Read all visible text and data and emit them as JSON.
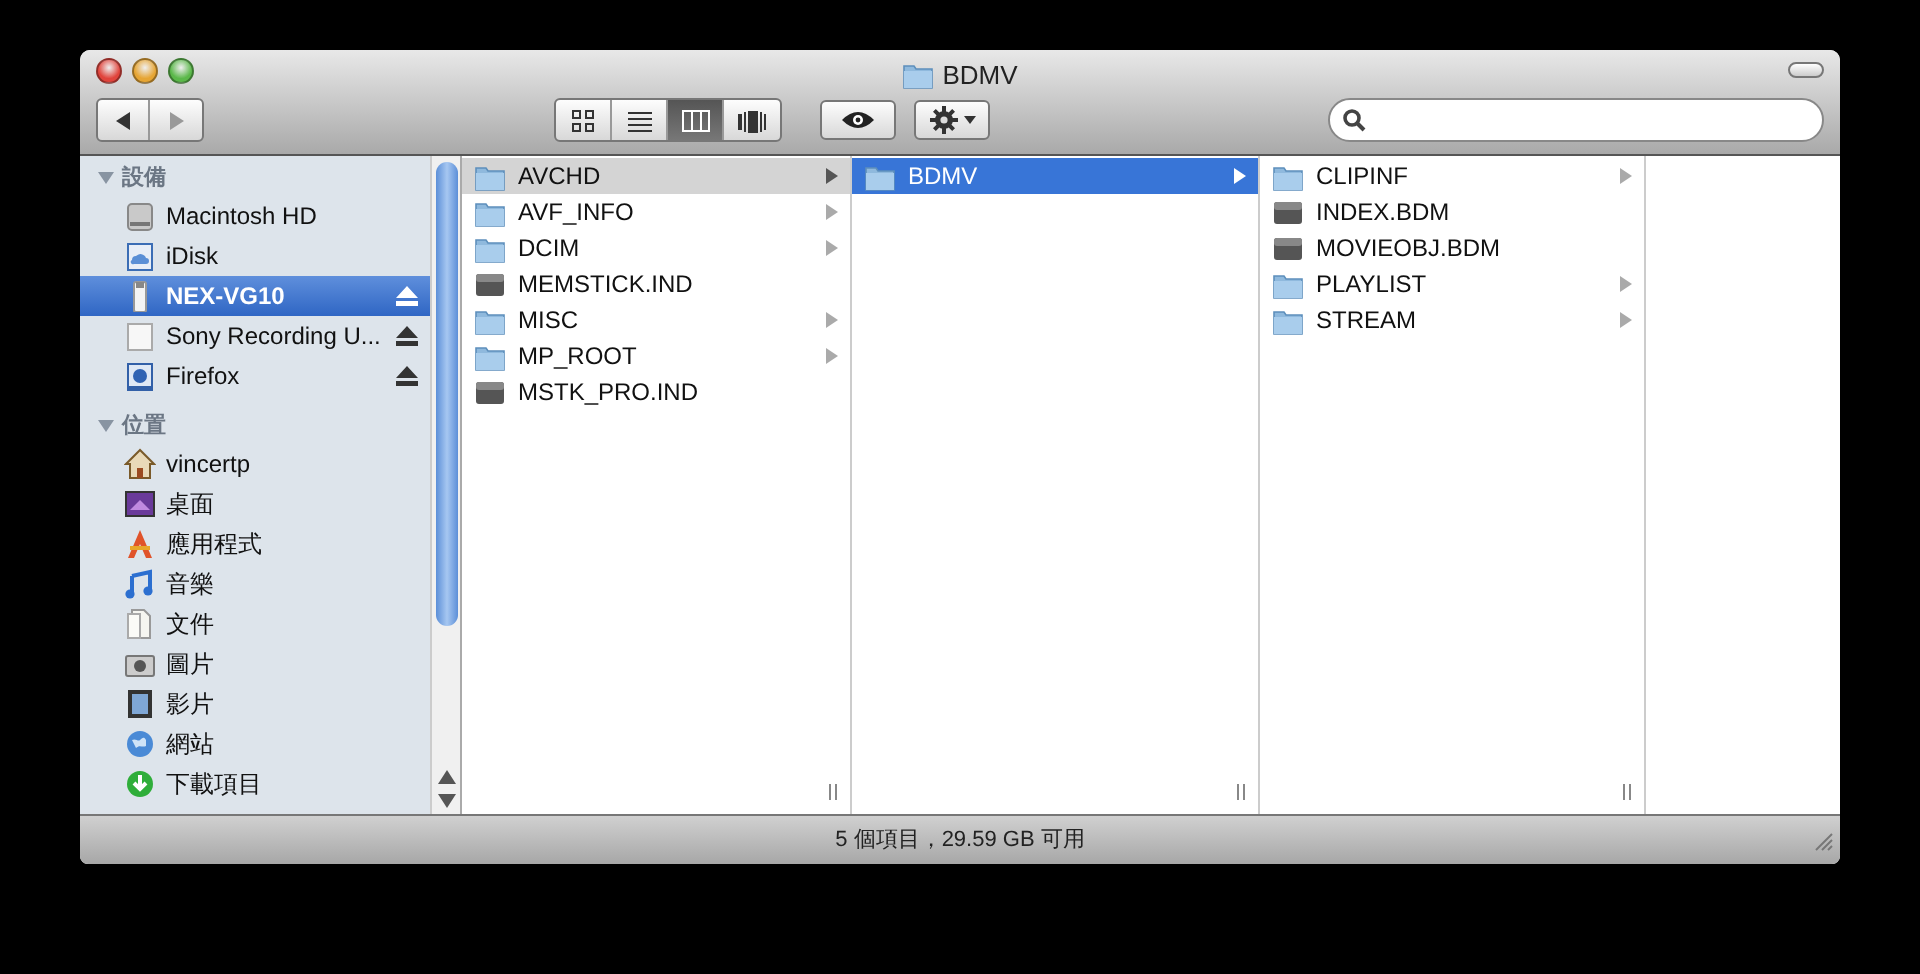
{
  "window": {
    "title": "BDMV"
  },
  "toolbar": {
    "view_buttons": [
      {
        "kind": "icon",
        "selected": false
      },
      {
        "kind": "list",
        "selected": false
      },
      {
        "kind": "column",
        "selected": true
      },
      {
        "kind": "coverflow",
        "selected": false
      }
    ]
  },
  "sidebar": {
    "sections": [
      {
        "label": "設備",
        "expanded": true,
        "items": [
          {
            "label": "Macintosh HD",
            "kind": "harddisk",
            "selected": false,
            "ejectable": false
          },
          {
            "label": "iDisk",
            "kind": "idisk",
            "selected": false,
            "ejectable": false
          },
          {
            "label": "NEX-VG10",
            "kind": "usb",
            "selected": true,
            "ejectable": true
          },
          {
            "label": "Sony Recording U...",
            "kind": "drive",
            "selected": false,
            "ejectable": true
          },
          {
            "label": "Firefox",
            "kind": "diskimage",
            "selected": false,
            "ejectable": true
          }
        ]
      },
      {
        "label": "位置",
        "expanded": true,
        "items": [
          {
            "label": "vincertp",
            "kind": "home",
            "selected": false,
            "ejectable": false
          },
          {
            "label": "桌面",
            "kind": "desktop",
            "selected": false,
            "ejectable": false
          },
          {
            "label": "應用程式",
            "kind": "apps",
            "selected": false,
            "ejectable": false
          },
          {
            "label": "音樂",
            "kind": "music",
            "selected": false,
            "ejectable": false
          },
          {
            "label": "文件",
            "kind": "documents",
            "selected": false,
            "ejectable": false
          },
          {
            "label": "圖片",
            "kind": "pictures",
            "selected": false,
            "ejectable": false
          },
          {
            "label": "影片",
            "kind": "movies",
            "selected": false,
            "ejectable": false
          },
          {
            "label": "網站",
            "kind": "sites",
            "selected": false,
            "ejectable": false
          },
          {
            "label": "下載項目",
            "kind": "downloads",
            "selected": false,
            "ejectable": false
          }
        ]
      }
    ]
  },
  "columns": [
    {
      "active": false,
      "items": [
        {
          "label": "AVCHD",
          "kind": "folder",
          "selected": true
        },
        {
          "label": "AVF_INFO",
          "kind": "folder",
          "selected": false
        },
        {
          "label": "DCIM",
          "kind": "folder",
          "selected": false
        },
        {
          "label": "MEMSTICK.IND",
          "kind": "file",
          "selected": false
        },
        {
          "label": "MISC",
          "kind": "folder",
          "selected": false
        },
        {
          "label": "MP_ROOT",
          "kind": "folder",
          "selected": false
        },
        {
          "label": "MSTK_PRO.IND",
          "kind": "file",
          "selected": false
        }
      ]
    },
    {
      "active": true,
      "items": [
        {
          "label": "BDMV",
          "kind": "folder",
          "selected": true
        }
      ]
    },
    {
      "items": [
        {
          "label": "CLIPINF",
          "kind": "folder",
          "selected": false
        },
        {
          "label": "INDEX.BDM",
          "kind": "file",
          "selected": false
        },
        {
          "label": "MOVIEOBJ.BDM",
          "kind": "file",
          "selected": false
        },
        {
          "label": "PLAYLIST",
          "kind": "folder",
          "selected": false
        },
        {
          "label": "STREAM",
          "kind": "folder",
          "selected": false
        }
      ]
    },
    {}
  ],
  "status_bar": {
    "text": "5 個項目，29.59 GB 可用"
  }
}
